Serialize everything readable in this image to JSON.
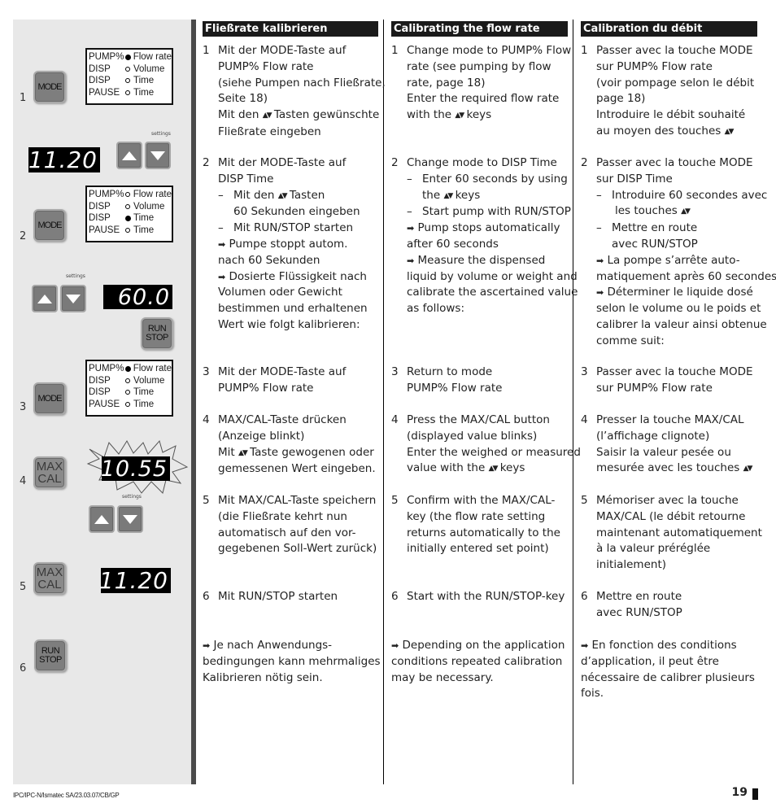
{
  "illustration": {
    "steps": [
      {
        "num": "1",
        "button": "MODE",
        "mode_display": [
          {
            "key": "PUMP%",
            "val": "Flow rate",
            "active": true
          },
          {
            "key": "DISP",
            "val": "Volume",
            "active": false
          },
          {
            "key": "DISP",
            "val": "Time",
            "active": false
          },
          {
            "key": "PAUSE",
            "val": "Time",
            "active": false
          }
        ],
        "lcd": "11.20",
        "settings_label": "settings"
      },
      {
        "num": "2",
        "button": "MODE",
        "mode_display": [
          {
            "key": "PUMP%",
            "val": "Flow rate",
            "active": false
          },
          {
            "key": "DISP",
            "val": "Volume",
            "active": false
          },
          {
            "key": "DISP",
            "val": "Time",
            "active": true
          },
          {
            "key": "PAUSE",
            "val": "Time",
            "active": false
          }
        ],
        "lcd": "60.0",
        "settings_label": "settings",
        "run_stop": [
          "RUN",
          "STOP"
        ]
      },
      {
        "num": "3",
        "button": "MODE",
        "mode_display": [
          {
            "key": "PUMP%",
            "val": "Flow rate",
            "active": true
          },
          {
            "key": "DISP",
            "val": "Volume",
            "active": false
          },
          {
            "key": "DISP",
            "val": "Time",
            "active": false
          },
          {
            "key": "PAUSE",
            "val": "Time",
            "active": false
          }
        ]
      },
      {
        "num": "4",
        "button": [
          "MAX",
          "CAL"
        ],
        "lcd": "10.55",
        "blinking": true,
        "settings_label": "settings"
      },
      {
        "num": "5",
        "button": [
          "MAX",
          "CAL"
        ],
        "lcd": "11.20"
      },
      {
        "num": "6",
        "button": [
          "RUN",
          "STOP"
        ]
      }
    ]
  },
  "columns": {
    "de": {
      "title": "Fließrate kalibrieren",
      "s1": [
        "Mit der MODE-Taste auf",
        "PUMP% Flow rate",
        "(siehe Pumpen nach Fließrate,",
        "Seite 18)",
        "Mit den",
        "Tasten gewünschte",
        "Fließrate eingeben"
      ],
      "s2": [
        "Mit der MODE-Taste auf",
        "DISP Time",
        "Mit den",
        "Tasten",
        "60 Sekunden eingeben",
        "Mit RUN/STOP starten",
        "Pumpe stoppt autom.",
        "nach 60 Sekunden",
        "Dosierte Flüssigkeit nach",
        "Volumen oder Gewicht",
        "bestimmen und erhaltenen",
        "Wert wie folgt kalibrieren:"
      ],
      "s3": [
        "Mit der MODE-Taste auf",
        "PUMP% Flow rate"
      ],
      "s4": [
        "MAX/CAL-Taste drücken",
        "(Anzeige blinkt)",
        "Mit",
        "Taste gewogenen oder",
        "gemessenen Wert eingeben."
      ],
      "s5": [
        "Mit MAX/CAL-Taste speichern",
        "(die Fließrate kehrt nun",
        "automatisch auf den vor-",
        "gegebenen Soll-Wert zurück)"
      ],
      "s6": [
        "Mit RUN/STOP starten"
      ],
      "note": [
        "Je nach Anwendungs-",
        "bedingungen kann mehrmaliges",
        "Kalibrieren nötig sein."
      ]
    },
    "en": {
      "title": "Calibrating the flow rate",
      "s1": [
        "Change mode to PUMP% Flow",
        "rate (see pumping by flow",
        "rate, page 18)",
        "Enter the required flow rate",
        "with the",
        "keys"
      ],
      "s2": [
        "Change mode to DISP Time",
        "Enter 60 seconds by using",
        "the",
        "keys",
        "Start pump with RUN/STOP",
        "Pump stops automatically",
        "after 60 seconds",
        "Measure the dispensed",
        "liquid by volume or weight and",
        "calibrate the ascertained value",
        "as follows:"
      ],
      "s3": [
        "Return to mode",
        "PUMP% Flow rate"
      ],
      "s4": [
        "Press the MAX/CAL button",
        "(displayed value blinks)",
        "Enter the weighed or measured",
        "value with the",
        "keys"
      ],
      "s5": [
        "Confirm with the MAX/CAL-",
        "key (the flow rate setting",
        "returns automatically to the",
        "initially entered set point)"
      ],
      "s6": [
        "Start with the RUN/STOP-key"
      ],
      "note": [
        "Depending on the application",
        "conditions repeated calibration",
        "may be necessary."
      ]
    },
    "fr": {
      "title": "Calibration du débit",
      "s1": [
        "Passer avec la touche MODE",
        "sur PUMP% Flow rate",
        "(voir pompage selon le débit",
        "page 18)",
        "Introduire le débit souhaité",
        "au moyen des touches"
      ],
      "s2": [
        "Passer avec la touche MODE",
        "sur DISP Time",
        "Introduire 60 secondes avec",
        "les touches",
        "Mettre en route",
        "avec RUN/STOP",
        "La pompe s’arrête auto-",
        "matiquement après 60 secondes",
        "Déterminer le liquide dosé",
        "selon le volume ou le poids et",
        "calibrer la valeur ainsi obtenue",
        "comme suit:"
      ],
      "s3": [
        "Passer avec la touche MODE",
        "sur PUMP% Flow rate"
      ],
      "s4": [
        "Presser la touche MAX/CAL",
        "(l’affichage clignote)",
        "Saisir la valeur pesée ou",
        "mesurée avec les touches"
      ],
      "s5": [
        "Mémoriser avec la touche",
        "MAX/CAL (le débit retourne",
        "maintenant automatiquement",
        "à la valeur préréglée",
        "initialement)"
      ],
      "s6": [
        "Mettre en route",
        "avec RUN/STOP"
      ],
      "note": [
        "En fonction des conditions",
        "d’application, il peut être",
        "nécessaire de calibrer plusieurs",
        "fois."
      ]
    },
    "step_numbers": [
      "1",
      "2",
      "3",
      "4",
      "5",
      "6"
    ],
    "symbols": {
      "updown": "▲▼",
      "arrow": "➡",
      "dash": "–"
    }
  },
  "footer": {
    "doc_ref": "IPC/IPC-N/Ismatec SA/23.03.07/CB/GP",
    "page_number": "19"
  }
}
